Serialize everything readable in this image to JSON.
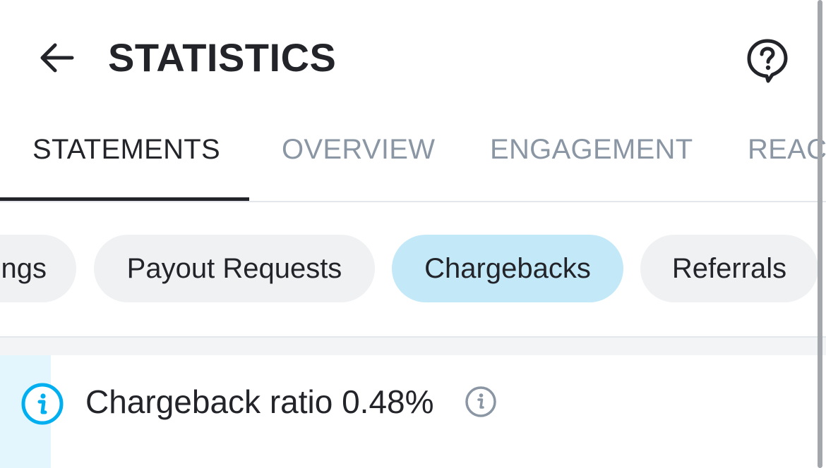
{
  "header": {
    "title": "STATISTICS",
    "back_icon": "arrow-left-icon",
    "help_icon": "help-bubble-icon"
  },
  "tabs": [
    {
      "label": "STATEMENTS",
      "active": true
    },
    {
      "label": "OVERVIEW",
      "active": false
    },
    {
      "label": "ENGAGEMENT",
      "active": false
    },
    {
      "label": "REACH",
      "active": false
    }
  ],
  "chips": [
    {
      "label": "Earnings",
      "selected": false
    },
    {
      "label": "Payout Requests",
      "selected": false
    },
    {
      "label": "Chargebacks",
      "selected": true
    },
    {
      "label": "Referrals",
      "selected": false
    }
  ],
  "info": {
    "text": "Chargeback ratio 0.48%",
    "icon": "info-circle-icon",
    "help_icon": "info-help-icon"
  },
  "colors": {
    "text_primary": "#222429",
    "tab_inactive": "#8a96a3",
    "chip_bg": "#eff1f3",
    "chip_selected_bg": "#c3e9f8",
    "accent_blue": "#00aff0",
    "info_accent_bg": "#e3f5fd"
  }
}
